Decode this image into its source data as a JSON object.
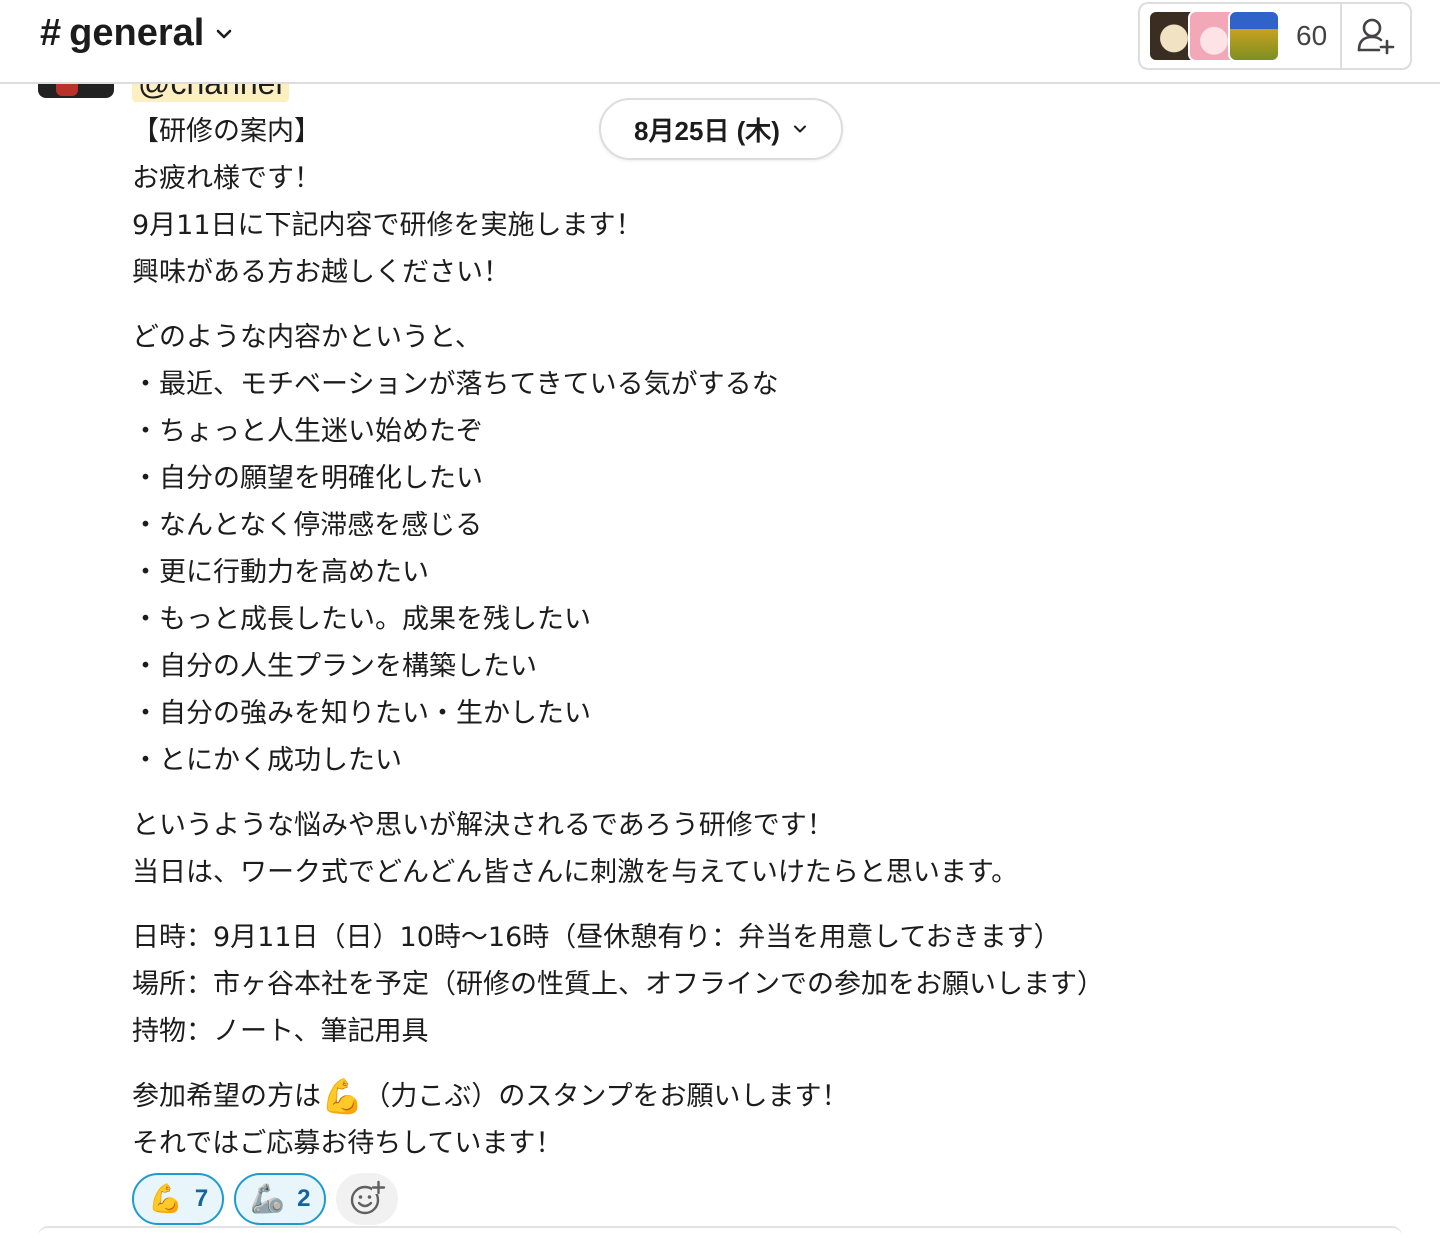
{
  "header": {
    "hash": "#",
    "channel_name": "general",
    "member_count": "60",
    "member_avatars": [
      "dog-avatar",
      "anime-avatar",
      "flowers-avatar"
    ]
  },
  "message": {
    "mention": "@channel",
    "date_divider": "8月25日 (木)",
    "lines": [
      "【研修の案内】",
      "お疲れ様です！",
      "9月11日に下記内容で研修を実施します！",
      "興味がある方お越しください！",
      "どのような内容かというと、",
      "・最近、モチベーションが落ちてきている気がするな",
      "・ちょっと人生迷い始めたぞ",
      "・自分の願望を明確化したい",
      "・なんとなく停滞感を感じる",
      "・更に行動力を高めたい",
      "・もっと成長したい。成果を残したい",
      "・自分の人生プランを構築したい",
      "・自分の強みを知りたい・生かしたい",
      "・とにかく成功したい",
      "というような悩みや思いが解決されるであろう研修です！",
      "当日は、ワーク式でどんどん皆さんに刺激を与えていけたらと思います。",
      "日時：9月11日（日）10時～16時（昼休憩有り：弁当を用意しておきます）",
      "場所：市ヶ谷本社を予定（研修の性質上、オフラインでの参加をお願いします）",
      "持物：ノート、筆記用具",
      "参加希望の方は",
      "（力こぶ）のスタンプをお願いします！",
      "それではご応募お待ちしています！"
    ],
    "arm_emoji": "💪"
  },
  "reactions": [
    {
      "emoji": "💪",
      "count": "7"
    },
    {
      "emoji": "🦾",
      "count": "2"
    }
  ],
  "colors": {
    "accent": "#1d9bd1",
    "reaction_bg": "#e8f5fa",
    "mention_bg": "#fcefc1",
    "text": "#1d1c1d"
  }
}
